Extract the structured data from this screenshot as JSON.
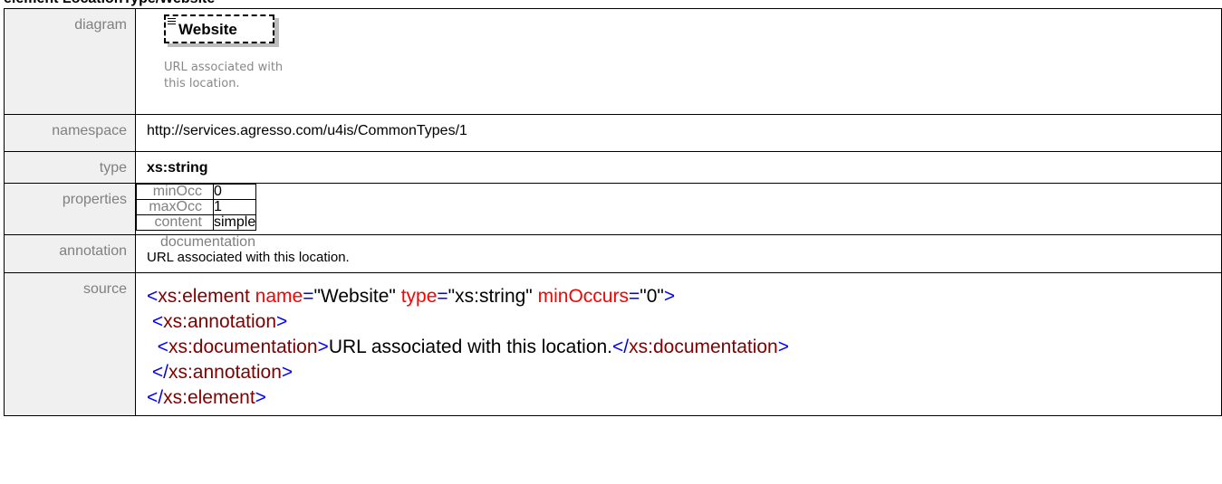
{
  "title": "element LocationType/Website",
  "rows": {
    "diagram": {
      "label": "diagram",
      "element_name": "Website",
      "doc": "URL associated with this location."
    },
    "namespace": {
      "label": "namespace",
      "value": "http://services.agresso.com/u4is/CommonTypes/1"
    },
    "type": {
      "label": "type",
      "value": "xs:string"
    },
    "properties": {
      "label": "properties",
      "items": [
        {
          "key": "minOcc",
          "value": "0"
        },
        {
          "key": "maxOcc",
          "value": "1"
        },
        {
          "key": "content",
          "value": "simple"
        }
      ]
    },
    "annotation": {
      "label": "annotation",
      "key": "documentation",
      "value": "URL associated with this location."
    },
    "source": {
      "label": "source",
      "lines": [
        [
          {
            "c": "t",
            "s": "<"
          },
          {
            "c": "n",
            "s": "xs:element"
          },
          {
            "c": "x",
            "s": " "
          },
          {
            "c": "a",
            "s": "name"
          },
          {
            "c": "t",
            "s": "="
          },
          {
            "c": "x",
            "s": "\"Website\""
          },
          {
            "c": "x",
            "s": " "
          },
          {
            "c": "a",
            "s": "type"
          },
          {
            "c": "t",
            "s": "="
          },
          {
            "c": "x",
            "s": "\"xs:string\""
          },
          {
            "c": "x",
            "s": " "
          },
          {
            "c": "a",
            "s": "minOccurs"
          },
          {
            "c": "t",
            "s": "="
          },
          {
            "c": "x",
            "s": "\"0\""
          },
          {
            "c": "t",
            "s": ">"
          }
        ],
        [
          {
            "c": "x",
            "s": " "
          },
          {
            "c": "t",
            "s": "<"
          },
          {
            "c": "n",
            "s": "xs:annotation"
          },
          {
            "c": "t",
            "s": ">"
          }
        ],
        [
          {
            "c": "x",
            "s": "  "
          },
          {
            "c": "t",
            "s": "<"
          },
          {
            "c": "n",
            "s": "xs:documentation"
          },
          {
            "c": "t",
            "s": ">"
          },
          {
            "c": "x",
            "s": "URL associated with this location."
          },
          {
            "c": "t",
            "s": "</"
          },
          {
            "c": "n",
            "s": "xs:documentation"
          },
          {
            "c": "t",
            "s": ">"
          }
        ],
        [
          {
            "c": "x",
            "s": " "
          },
          {
            "c": "t",
            "s": "</"
          },
          {
            "c": "n",
            "s": "xs:annotation"
          },
          {
            "c": "t",
            "s": ">"
          }
        ],
        [
          {
            "c": "t",
            "s": "</"
          },
          {
            "c": "n",
            "s": "xs:element"
          },
          {
            "c": "t",
            "s": ">"
          }
        ]
      ]
    }
  },
  "colors": {
    "tag_bracket": "#0000ff",
    "tag_name": "#800000",
    "attribute": "#ff0000",
    "text": "#000000",
    "label": "#808080",
    "label_bg": "#f0f0f0"
  }
}
